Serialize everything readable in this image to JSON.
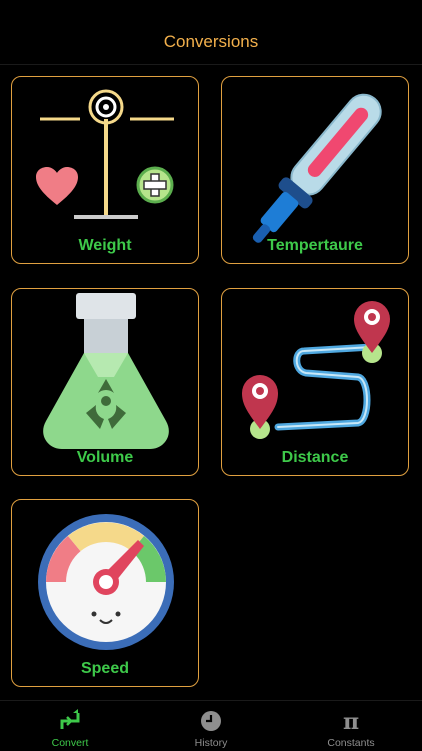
{
  "header": {
    "title": "Conversions"
  },
  "cards": {
    "weight": {
      "label": "Weight",
      "icon": "balance-scale-icon"
    },
    "temperature": {
      "label": "Tempertaure",
      "icon": "thermometer-icon"
    },
    "volume": {
      "label": "Volume",
      "icon": "flask-icon"
    },
    "distance": {
      "label": "Distance",
      "icon": "route-map-pins-icon"
    },
    "speed": {
      "label": "Speed",
      "icon": "speedometer-icon"
    }
  },
  "tabs": {
    "convert": {
      "label": "Convert",
      "icon": "convert-arrows-icon",
      "active": true
    },
    "history": {
      "label": "History",
      "icon": "clock-icon",
      "active": false
    },
    "constants": {
      "label": "Constants",
      "icon": "pi-icon",
      "active": false
    }
  },
  "colors": {
    "accent_orange": "#f2b04c",
    "accent_green": "#3ec94a",
    "inactive_tab": "#8e8e8e",
    "background": "#000000"
  }
}
